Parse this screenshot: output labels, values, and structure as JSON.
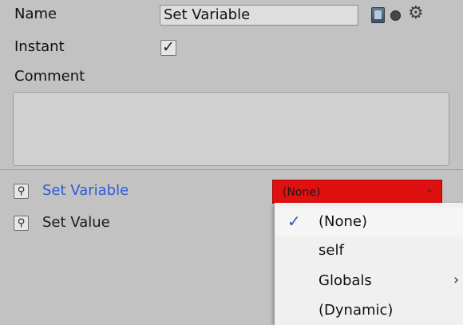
{
  "fields": {
    "name_label": "Name",
    "name_value": "Set Variable",
    "instant_label": "Instant",
    "instant_checked": true,
    "comment_label": "Comment",
    "comment_value": ""
  },
  "header_icons": [
    "book-icon",
    "circle-icon",
    "gear-icon"
  ],
  "params": [
    {
      "label": "Set Variable",
      "color": "#2e5bd6"
    },
    {
      "label": "Set Value",
      "color": "#1a1a1a"
    }
  ],
  "dropdown": {
    "selected": "(None)",
    "arrow": "÷",
    "color": "#e01010"
  },
  "menu": {
    "items": [
      {
        "label": "(None)",
        "checked": true,
        "has_submenu": false
      },
      {
        "label": "self",
        "checked": false,
        "has_submenu": false
      },
      {
        "label": "Globals",
        "checked": false,
        "has_submenu": true
      },
      {
        "label": "(Dynamic)",
        "checked": false,
        "has_submenu": false
      }
    ],
    "check_glyph": "✓",
    "submenu_glyph": "›"
  }
}
